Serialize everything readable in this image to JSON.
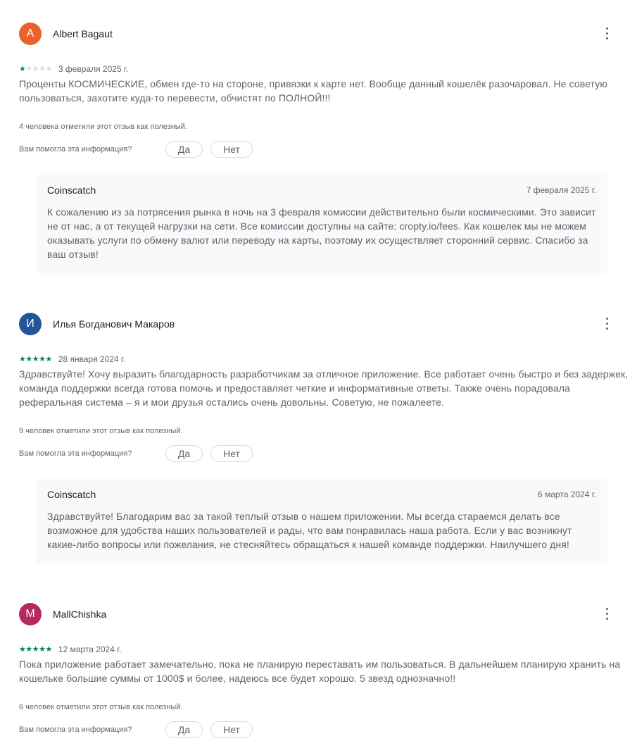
{
  "colors": {
    "star_filled": "#01875f",
    "star_empty": "#dadce0",
    "reply_background": "#f8f9fa"
  },
  "reviews": [
    {
      "avatar_letter": "A",
      "avatar_color": "#e8622c",
      "author": "Albert Bagaut",
      "rating": 1,
      "date": "3 февраля 2025 г.",
      "text": "Проценты КОСМИЧЕСКИЕ, обмен где-то на стороне, привязки к карте нет. Вообще данный кошелёк разочаровал. Не советую пользоваться, захотите куда-то перевести, обчистят по ПОЛНОЙ!!!",
      "helpful_count": "4 человека отметили этот отзыв как полезный.",
      "helpful_question": "Вам помогла эта информация?",
      "yes_label": "Да",
      "no_label": "Нет",
      "reply": {
        "author": "Coinscatch",
        "date": "7 февраля 2025 г.",
        "text": "К сожалению из за потрясения рынка в ночь на 3 февраля комиссии действительно были космическими. Это зависит не от нас, а от текущей нагрузки на сети. Все комиссии доступны на сайте: cropty.io/fees. Как кошелек мы не можем оказывать услуги по обмену валют или переводу на карты, поэтому их осуществляет сторонний сервис. Спасибо за ваш отзыв!"
      }
    },
    {
      "avatar_letter": "И",
      "avatar_color": "#245597",
      "author": "Илья Богданович Макаров",
      "rating": 5,
      "date": "28 января 2024 г.",
      "text": "Здравствуйте! Хочу выразить благодарность разработчикам за отличное приложение. Все работает очень быстро и без задержек, команда поддержки всегда готова помочь и предоставляет четкие и информативные ответы. Также очень порадовала реферальная система – я и мои друзья остались очень довольны. Советую, не пожалеете.",
      "helpful_count": "9 человек отметили этот отзыв как полезный.",
      "helpful_question": "Вам помогла эта информация?",
      "yes_label": "Да",
      "no_label": "Нет",
      "reply": {
        "author": "Coinscatch",
        "date": "6 марта 2024 г.",
        "text": "Здравствуйте! Благодарим вас за такой теплый отзыв о нашем приложении. Мы всегда стараемся делать все возможное для удобства наших пользователей и рады, что вам понравилась наша работа. Если у вас возникнут какие-либо вопросы или пожелания, не стесняйтесь обращаться к нашей команде поддержки. Наилучшего дня!"
      }
    },
    {
      "avatar_letter": "M",
      "avatar_color": "#b5295f",
      "author": "MallChishka",
      "rating": 5,
      "date": "12 марта 2024 г.",
      "text": "Пока приложение работает замечательно, пока не планирую переставать им пользоваться. В дальнейшем планирую хранить на кошельке большие суммы от 1000$ и более, надеюсь все будет хорошо. 5 звезд однозначно!!",
      "helpful_count": "6 человек отметили этот отзыв как полезный.",
      "helpful_question": "Вам помогла эта информация?",
      "yes_label": "Да",
      "no_label": "Нет"
    }
  ]
}
